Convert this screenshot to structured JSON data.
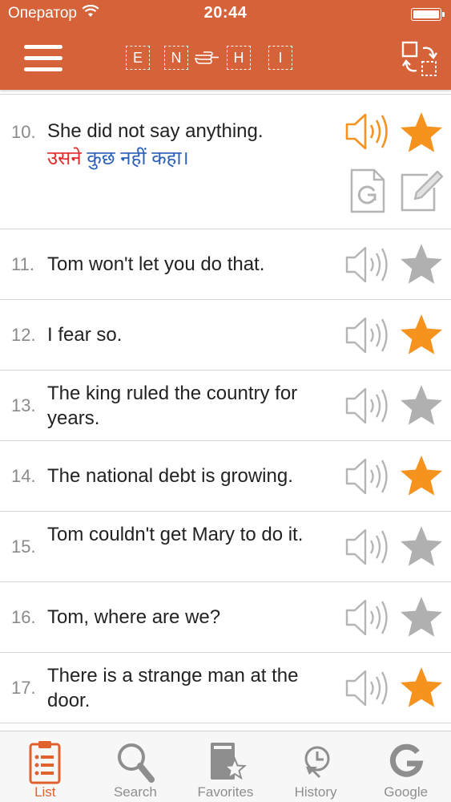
{
  "status_bar": {
    "carrier": "Оператор",
    "time": "20:44"
  },
  "header": {
    "langs": [
      "E",
      "N",
      "H",
      "I"
    ],
    "icons": [
      "menu-icon",
      "pointing-hand-icon",
      "swap-layout-icon"
    ]
  },
  "colors": {
    "brand": "#d6623a",
    "accent_orange": "#f5931e",
    "inactive_gray": "#b0b0b0",
    "hindi_red": "#e52b2b",
    "hindi_blue": "#2b5fb8"
  },
  "sentences": [
    {
      "num": "10.",
      "text": "She did not say anything.",
      "translation_red": "उसने",
      "translation_blue": " कुछ नहीं कहा।",
      "favorite": true,
      "playing": true
    },
    {
      "num": "11.",
      "text": "Tom won't let you do that.",
      "favorite": false
    },
    {
      "num": "12.",
      "text": "I fear so.",
      "favorite": true
    },
    {
      "num": "13.",
      "text": "The king ruled the country for years.",
      "favorite": false
    },
    {
      "num": "14.",
      "text": "The national debt is growing.",
      "favorite": true
    },
    {
      "num": "15.",
      "text": "Tom couldn't get Mary to do it.",
      "favorite": false
    },
    {
      "num": "16.",
      "text": "Tom, where are we?",
      "favorite": false
    },
    {
      "num": "17.",
      "text": "There is a strange man at the door.",
      "favorite": true
    }
  ],
  "tabs": [
    {
      "label": "List",
      "icon": "clipboard-list-icon",
      "active": true
    },
    {
      "label": "Search",
      "icon": "magnifier-icon",
      "active": false
    },
    {
      "label": "Favorites",
      "icon": "book-star-icon",
      "active": false
    },
    {
      "label": "History",
      "icon": "clock-history-icon",
      "active": false
    },
    {
      "label": "Google",
      "icon": "google-g-icon",
      "active": false
    }
  ]
}
